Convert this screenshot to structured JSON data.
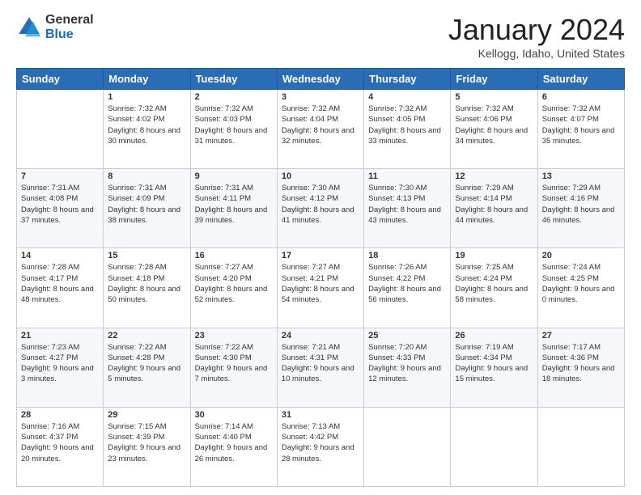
{
  "header": {
    "logo_general": "General",
    "logo_blue": "Blue",
    "month_title": "January 2024",
    "location": "Kellogg, Idaho, United States"
  },
  "days_of_week": [
    "Sunday",
    "Monday",
    "Tuesday",
    "Wednesday",
    "Thursday",
    "Friday",
    "Saturday"
  ],
  "weeks": [
    [
      {
        "num": "",
        "sunrise": "",
        "sunset": "",
        "daylight": ""
      },
      {
        "num": "1",
        "sunrise": "Sunrise: 7:32 AM",
        "sunset": "Sunset: 4:02 PM",
        "daylight": "Daylight: 8 hours and 30 minutes."
      },
      {
        "num": "2",
        "sunrise": "Sunrise: 7:32 AM",
        "sunset": "Sunset: 4:03 PM",
        "daylight": "Daylight: 8 hours and 31 minutes."
      },
      {
        "num": "3",
        "sunrise": "Sunrise: 7:32 AM",
        "sunset": "Sunset: 4:04 PM",
        "daylight": "Daylight: 8 hours and 32 minutes."
      },
      {
        "num": "4",
        "sunrise": "Sunrise: 7:32 AM",
        "sunset": "Sunset: 4:05 PM",
        "daylight": "Daylight: 8 hours and 33 minutes."
      },
      {
        "num": "5",
        "sunrise": "Sunrise: 7:32 AM",
        "sunset": "Sunset: 4:06 PM",
        "daylight": "Daylight: 8 hours and 34 minutes."
      },
      {
        "num": "6",
        "sunrise": "Sunrise: 7:32 AM",
        "sunset": "Sunset: 4:07 PM",
        "daylight": "Daylight: 8 hours and 35 minutes."
      }
    ],
    [
      {
        "num": "7",
        "sunrise": "Sunrise: 7:31 AM",
        "sunset": "Sunset: 4:08 PM",
        "daylight": "Daylight: 8 hours and 37 minutes."
      },
      {
        "num": "8",
        "sunrise": "Sunrise: 7:31 AM",
        "sunset": "Sunset: 4:09 PM",
        "daylight": "Daylight: 8 hours and 38 minutes."
      },
      {
        "num": "9",
        "sunrise": "Sunrise: 7:31 AM",
        "sunset": "Sunset: 4:11 PM",
        "daylight": "Daylight: 8 hours and 39 minutes."
      },
      {
        "num": "10",
        "sunrise": "Sunrise: 7:30 AM",
        "sunset": "Sunset: 4:12 PM",
        "daylight": "Daylight: 8 hours and 41 minutes."
      },
      {
        "num": "11",
        "sunrise": "Sunrise: 7:30 AM",
        "sunset": "Sunset: 4:13 PM",
        "daylight": "Daylight: 8 hours and 43 minutes."
      },
      {
        "num": "12",
        "sunrise": "Sunrise: 7:29 AM",
        "sunset": "Sunset: 4:14 PM",
        "daylight": "Daylight: 8 hours and 44 minutes."
      },
      {
        "num": "13",
        "sunrise": "Sunrise: 7:29 AM",
        "sunset": "Sunset: 4:16 PM",
        "daylight": "Daylight: 8 hours and 46 minutes."
      }
    ],
    [
      {
        "num": "14",
        "sunrise": "Sunrise: 7:28 AM",
        "sunset": "Sunset: 4:17 PM",
        "daylight": "Daylight: 8 hours and 48 minutes."
      },
      {
        "num": "15",
        "sunrise": "Sunrise: 7:28 AM",
        "sunset": "Sunset: 4:18 PM",
        "daylight": "Daylight: 8 hours and 50 minutes."
      },
      {
        "num": "16",
        "sunrise": "Sunrise: 7:27 AM",
        "sunset": "Sunset: 4:20 PM",
        "daylight": "Daylight: 8 hours and 52 minutes."
      },
      {
        "num": "17",
        "sunrise": "Sunrise: 7:27 AM",
        "sunset": "Sunset: 4:21 PM",
        "daylight": "Daylight: 8 hours and 54 minutes."
      },
      {
        "num": "18",
        "sunrise": "Sunrise: 7:26 AM",
        "sunset": "Sunset: 4:22 PM",
        "daylight": "Daylight: 8 hours and 56 minutes."
      },
      {
        "num": "19",
        "sunrise": "Sunrise: 7:25 AM",
        "sunset": "Sunset: 4:24 PM",
        "daylight": "Daylight: 8 hours and 58 minutes."
      },
      {
        "num": "20",
        "sunrise": "Sunrise: 7:24 AM",
        "sunset": "Sunset: 4:25 PM",
        "daylight": "Daylight: 9 hours and 0 minutes."
      }
    ],
    [
      {
        "num": "21",
        "sunrise": "Sunrise: 7:23 AM",
        "sunset": "Sunset: 4:27 PM",
        "daylight": "Daylight: 9 hours and 3 minutes."
      },
      {
        "num": "22",
        "sunrise": "Sunrise: 7:22 AM",
        "sunset": "Sunset: 4:28 PM",
        "daylight": "Daylight: 9 hours and 5 minutes."
      },
      {
        "num": "23",
        "sunrise": "Sunrise: 7:22 AM",
        "sunset": "Sunset: 4:30 PM",
        "daylight": "Daylight: 9 hours and 7 minutes."
      },
      {
        "num": "24",
        "sunrise": "Sunrise: 7:21 AM",
        "sunset": "Sunset: 4:31 PM",
        "daylight": "Daylight: 9 hours and 10 minutes."
      },
      {
        "num": "25",
        "sunrise": "Sunrise: 7:20 AM",
        "sunset": "Sunset: 4:33 PM",
        "daylight": "Daylight: 9 hours and 12 minutes."
      },
      {
        "num": "26",
        "sunrise": "Sunrise: 7:19 AM",
        "sunset": "Sunset: 4:34 PM",
        "daylight": "Daylight: 9 hours and 15 minutes."
      },
      {
        "num": "27",
        "sunrise": "Sunrise: 7:17 AM",
        "sunset": "Sunset: 4:36 PM",
        "daylight": "Daylight: 9 hours and 18 minutes."
      }
    ],
    [
      {
        "num": "28",
        "sunrise": "Sunrise: 7:16 AM",
        "sunset": "Sunset: 4:37 PM",
        "daylight": "Daylight: 9 hours and 20 minutes."
      },
      {
        "num": "29",
        "sunrise": "Sunrise: 7:15 AM",
        "sunset": "Sunset: 4:39 PM",
        "daylight": "Daylight: 9 hours and 23 minutes."
      },
      {
        "num": "30",
        "sunrise": "Sunrise: 7:14 AM",
        "sunset": "Sunset: 4:40 PM",
        "daylight": "Daylight: 9 hours and 26 minutes."
      },
      {
        "num": "31",
        "sunrise": "Sunrise: 7:13 AM",
        "sunset": "Sunset: 4:42 PM",
        "daylight": "Daylight: 9 hours and 28 minutes."
      },
      {
        "num": "",
        "sunrise": "",
        "sunset": "",
        "daylight": ""
      },
      {
        "num": "",
        "sunrise": "",
        "sunset": "",
        "daylight": ""
      },
      {
        "num": "",
        "sunrise": "",
        "sunset": "",
        "daylight": ""
      }
    ]
  ]
}
